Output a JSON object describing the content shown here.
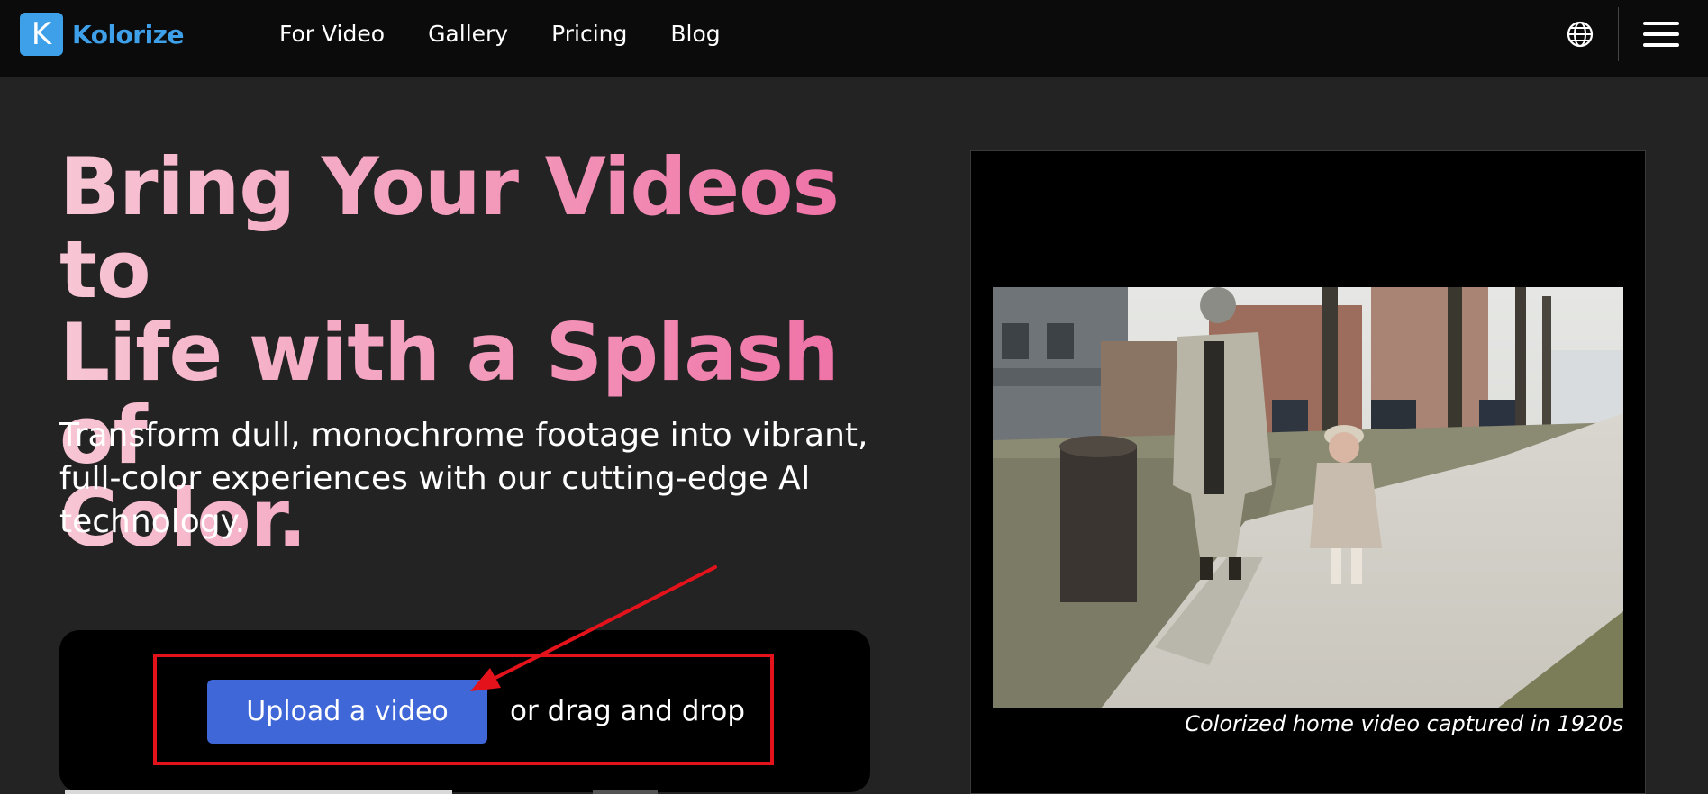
{
  "brand": {
    "logo_letter": "K",
    "name": "Kolorize",
    "color": "#3fa0ea"
  },
  "nav": {
    "items": [
      {
        "label": "For Video"
      },
      {
        "label": "Gallery"
      },
      {
        "label": "Pricing"
      },
      {
        "label": "Blog"
      }
    ],
    "icons": [
      "globe-icon",
      "hamburger-menu-icon"
    ]
  },
  "hero": {
    "headline_line1": "Bring Your Videos to",
    "headline_line2": "Life with a Splash of",
    "headline_line3": "Color.",
    "subtext": "Transform dull, monochrome footage into vibrant, full-color experiences with our cutting-edge AI technology.",
    "gradient": [
      "#f7c6d4",
      "#ee6aa2"
    ]
  },
  "upload": {
    "button_label": "Upload a video",
    "drag_text": "or drag and drop",
    "button_color": "#3f67d8",
    "highlight_color": "#e4131b"
  },
  "video": {
    "caption": "Colorized home video captured in 1920s"
  }
}
